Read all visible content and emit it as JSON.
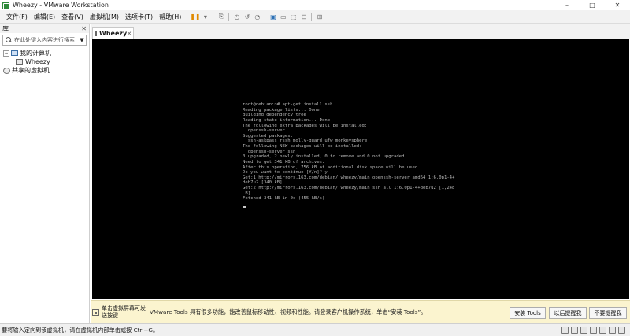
{
  "window": {
    "title": "Wheezy - VMware Workstation",
    "controls": {
      "minimize": "–",
      "maximize": "□",
      "close": "✕"
    }
  },
  "menu": [
    "文件(F)",
    "编辑(E)",
    "查看(V)",
    "虚拟机(M)",
    "选项卡(T)",
    "帮助(H)"
  ],
  "toolbar_icons": [
    "pause-icon",
    "dropdown-icon",
    "send-ctrl-alt-del-icon",
    "snapshot-icon",
    "revert-snapshot-icon",
    "manage-snapshots-icon",
    "sidebar-icon",
    "console-view-icon",
    "fullscreen-icon",
    "unity-icon",
    "view-icon"
  ],
  "sidebar": {
    "title": "库",
    "close": "✕",
    "search_placeholder": "在此处键入内容进行搜索",
    "tree": {
      "my_computer": "我的计算机",
      "vm": "Wheezy",
      "shared": "共享的虚拟机"
    }
  },
  "tab": {
    "label": "Wheezy",
    "close": "✕"
  },
  "terminal": {
    "lines": [
      "root@debian:~# apt-get install ssh",
      "Reading package lists... Done",
      "Building dependency tree",
      "Reading state information... Done",
      "The following extra packages will be installed:",
      "  openssh-server",
      "Suggested packages:",
      "  ssh-askpass rssh molly-guard ufw monkeysphere",
      "The following NEW packages will be installed:",
      "  openssh-server ssh",
      "0 upgraded, 2 newly installed, 0 to remove and 0 not upgraded.",
      "Need to get 341 kB of archives.",
      "After this operation, 756 kB of additional disk space will be used.",
      "Do you want to continue [Y/n]? y",
      "Get:1 http://mirrors.163.com/debian/ wheezy/main openssh-server amd64 1:6.0p1-4+",
      "deb7u2 [340 kB]",
      "Get:2 http://mirrors.163.com/debian/ wheezy/main ssh all 1:6.0p1-4+deb7u2 [1,248",
      " B]",
      "Fetched 341 kB in 0s (455 kB/s)"
    ]
  },
  "notification": {
    "hint": "单击虚拟屏幕可发送按键",
    "message": "VMware Tools 具有很多功能，能改善鼠标移动性、视频和性能。请登录客户机操作系统，单击“安装 Tools”。",
    "buttons": [
      "安装 Tools",
      "以后提醒我",
      "不要提醒我"
    ]
  },
  "statusbar": {
    "text": "要将输入定向到该虚拟机，请在虚拟机内部单击或按 Ctrl+G。"
  }
}
